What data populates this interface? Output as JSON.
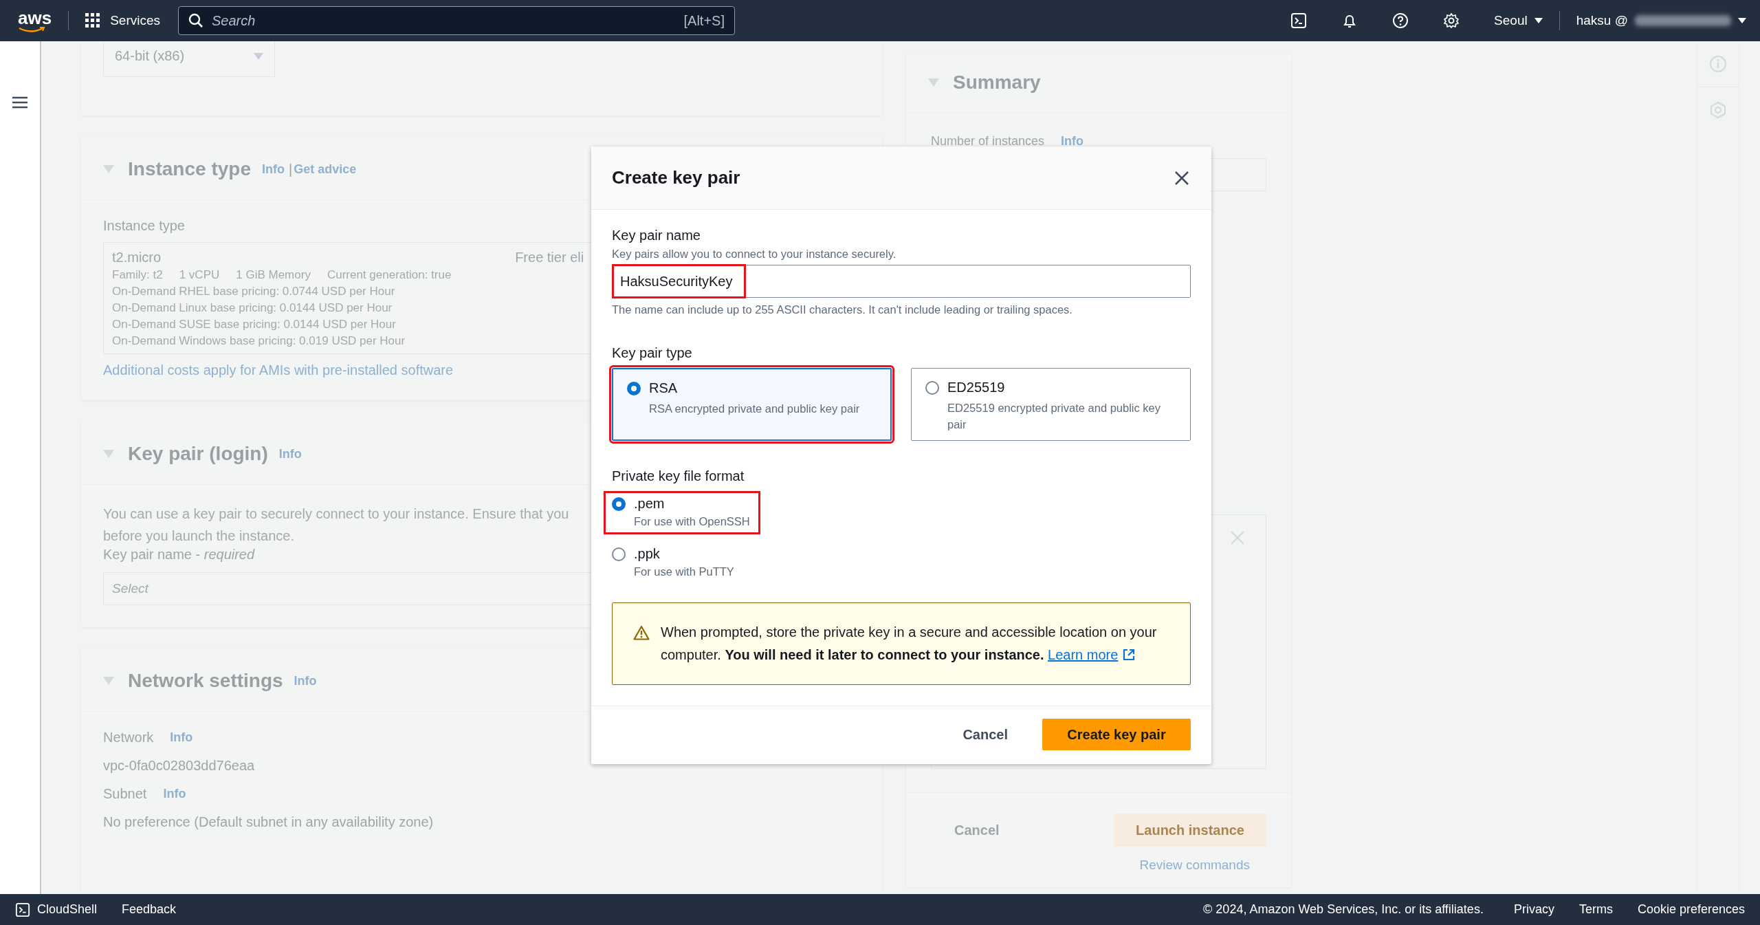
{
  "top_bar": {
    "logo": "aws",
    "services": "Services",
    "search": {
      "placeholder": "Search",
      "shortcut": "[Alt+S]"
    },
    "region": "Seoul",
    "user": "haksu @"
  },
  "page": {
    "ami_panel": {
      "architecture": "64-bit (x86)"
    },
    "instance_type": {
      "title": "Instance type",
      "info": "Info",
      "separator": "|",
      "advice": "Get advice",
      "field_label": "Instance type",
      "selected": "t2.micro",
      "badge": "Free tier eli",
      "specs": [
        "Family: t2",
        "1 vCPU",
        "1 GiB Memory",
        "Current generation: true"
      ],
      "pricing": [
        "On-Demand RHEL base pricing: 0.0744 USD per Hour",
        "On-Demand Linux base pricing: 0.0144 USD per Hour",
        "On-Demand SUSE base pricing: 0.0144 USD per Hour",
        "On-Demand Windows base pricing: 0.019 USD per Hour"
      ],
      "link": "Additional costs apply for AMIs with pre-installed software"
    },
    "key_pair": {
      "title": "Key pair (login)",
      "info": "Info",
      "description_lines": [
        "You can use a key pair to securely connect to your instance. Ensure that you",
        "before you launch the instance."
      ],
      "field_label": "Key pair name - ",
      "required": "required",
      "placeholder": "Select"
    },
    "network": {
      "title": "Network settings",
      "info": "Info",
      "fields": [
        {
          "label": "Network",
          "info": "Info",
          "value": "vpc-0fa0c02803dd76eaa"
        },
        {
          "label": "Subnet",
          "info": "Info",
          "value": "No preference (Default subnet in any availability zone)"
        }
      ]
    },
    "summary": {
      "title": "Summary",
      "instances_label": "Number of instances",
      "info": "Info",
      "cancel": "Cancel",
      "launch": "Launch instance",
      "review": "Review commands"
    }
  },
  "dialog": {
    "title": "Create key pair",
    "name": {
      "label": "Key pair name",
      "description": "Key pairs allow you to connect to your instance securely.",
      "value": "HaksuSecurityKey",
      "highlighted": true,
      "constraint": "The name can include up to 255 ASCII characters. It can't include leading or trailing spaces."
    },
    "type": {
      "label": "Key pair type",
      "options": [
        {
          "label": "RSA",
          "description": "RSA encrypted private and public key pair",
          "selected": true,
          "highlighted": true
        },
        {
          "label": "ED25519",
          "description": "ED25519 encrypted private and public key pair",
          "selected": false,
          "highlighted": false
        }
      ]
    },
    "format": {
      "label": "Private key file format",
      "options": [
        {
          "label": ".pem",
          "description": "For use with OpenSSH",
          "selected": true,
          "highlighted": true
        },
        {
          "label": ".ppk",
          "description": "For use with PuTTY",
          "selected": false,
          "highlighted": false
        }
      ]
    },
    "alert": {
      "text": "When prompted, store the private key in a secure and accessible location on your computer. **You will need it later to connect to your instance.**",
      "link": "Learn more"
    },
    "cancel": "Cancel",
    "submit": "Create key pair"
  },
  "footer": {
    "cloudshell": "CloudShell",
    "feedback": "Feedback",
    "copyright": "© 2024, Amazon Web Services, Inc. or its affiliates.",
    "links": [
      "Privacy",
      "Terms",
      "Cookie preferences"
    ]
  }
}
